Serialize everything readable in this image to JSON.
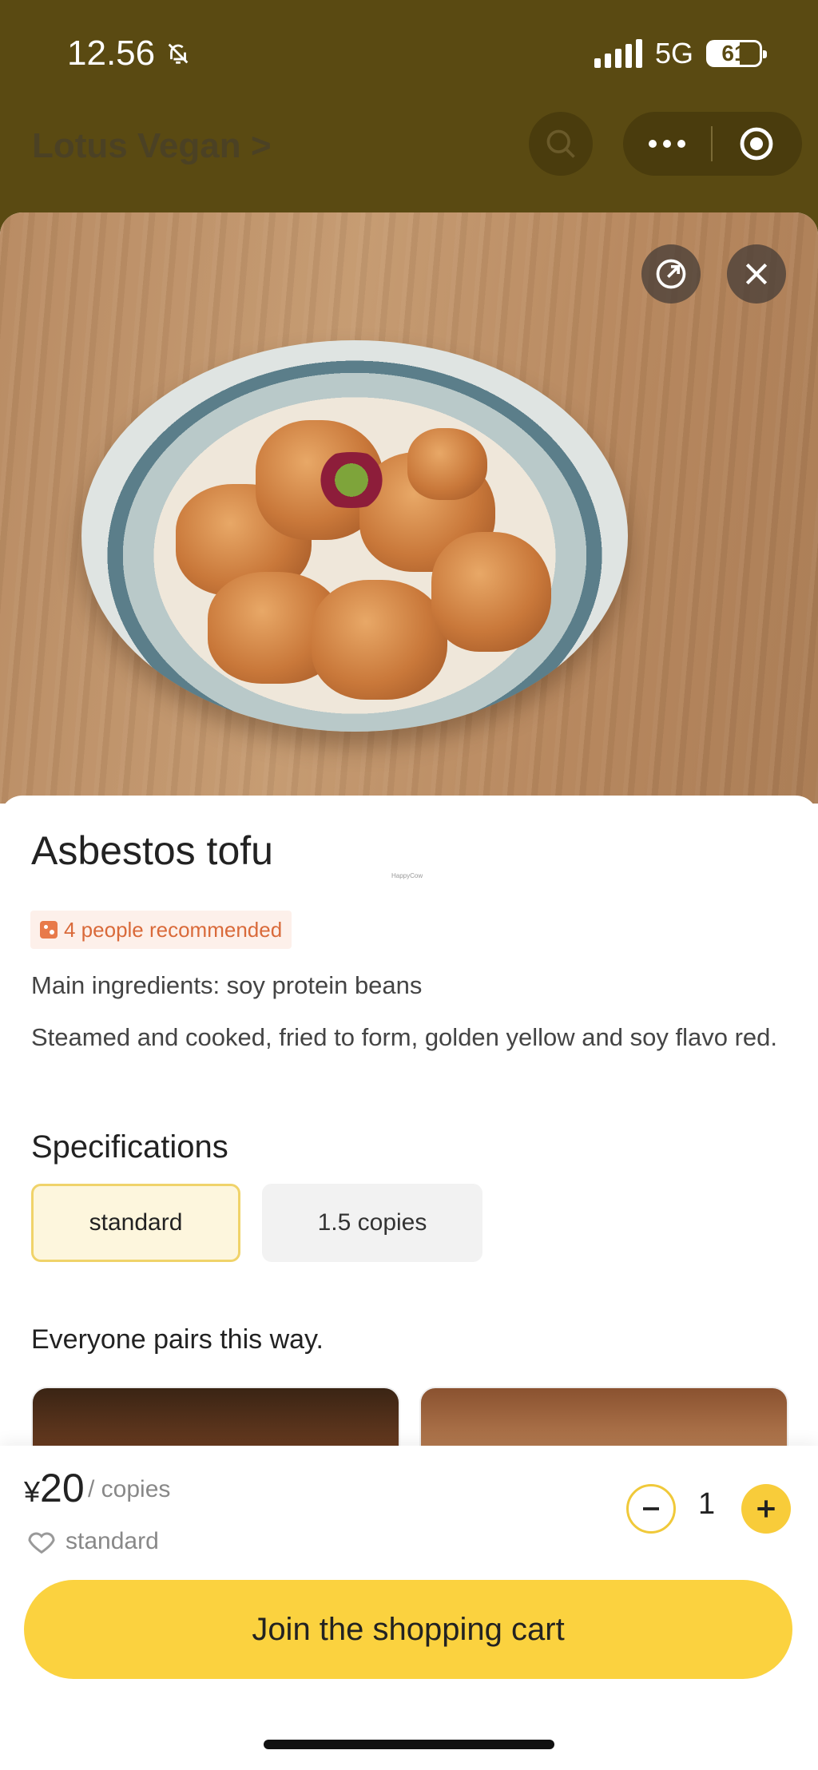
{
  "status_bar": {
    "time": "12.56",
    "network": "5G",
    "battery": "61"
  },
  "header": {
    "store_title": "Lotus Vegan >"
  },
  "dish": {
    "name": "Asbestos tofu",
    "watermark": "HappyCow",
    "recommend_text": "4 people recommended",
    "ingredients": "Main ingredients: soy protein beans",
    "description": "Steamed and cooked, fried to form, golden yellow and soy flavo red."
  },
  "specifications": {
    "title": "Specifications",
    "options": [
      "standard",
      "1.5 copies"
    ],
    "selected": "standard"
  },
  "pairs": {
    "title": "Everyone pairs this way."
  },
  "purchase": {
    "currency": "¥",
    "price": "20",
    "unit": "/ copies",
    "selected_spec": "standard",
    "quantity": "1",
    "cart_button": "Join the shopping cart"
  },
  "colors": {
    "header_bg": "#5a4a12",
    "accent": "#fbd23f",
    "badge_text": "#d96a3a"
  },
  "icons": [
    "bell-off-icon",
    "search-icon",
    "more-icon",
    "target-icon",
    "share-icon",
    "close-icon",
    "heart-icon",
    "minus-icon",
    "plus-icon"
  ]
}
